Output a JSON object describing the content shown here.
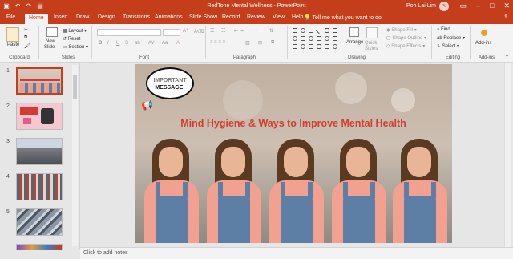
{
  "window": {
    "title": "RedTone Mental Wellness  -  PowerPoint",
    "user_name": "Poh Lai Lim",
    "user_initials": "PL"
  },
  "tabs": [
    "File",
    "Home",
    "Insert",
    "Draw",
    "Design",
    "Transitions",
    "Animations",
    "Slide Show",
    "Record",
    "Review",
    "View",
    "Help"
  ],
  "tell_me": "Tell me what you want to do",
  "ribbon": {
    "clipboard": {
      "paste": "Paste",
      "label": "Clipboard"
    },
    "slides": {
      "new_slide": "New",
      "new_slide2": "Slide",
      "layout": "Layout",
      "reset": "Reset",
      "section": "Section",
      "label": "Slides"
    },
    "font": {
      "label": "Font",
      "bold": "B",
      "italic": "I",
      "underline": "U",
      "strike": "S"
    },
    "paragraph": {
      "label": "Paragraph"
    },
    "drawing": {
      "arrange": "Arrange",
      "quick_styles": "Quick Styles",
      "shape_fill": "Shape Fill",
      "shape_outline": "Shape Outline",
      "shape_effects": "Shape Effects",
      "label": "Drawing"
    },
    "editing": {
      "find": "Find",
      "replace": "Replace",
      "select": "Select",
      "label": "Editing"
    },
    "addins": {
      "addins": "Add-ins",
      "label": "Add-ins"
    }
  },
  "slides_panel": {
    "thumbnails": [
      {
        "number": "1",
        "selected": true
      },
      {
        "number": "2",
        "selected": false
      },
      {
        "number": "3",
        "selected": false
      },
      {
        "number": "4",
        "selected": false
      },
      {
        "number": "5",
        "selected": false
      }
    ]
  },
  "slide": {
    "bubble_line1": "IMPORTANT",
    "bubble_line2": "MESSAGE!",
    "headline": "Mind Hygiene & Ways to Improve Mental Health"
  },
  "notes_placeholder": "Click to add notes",
  "colors": {
    "accent": "#c43e1c",
    "headline": "#d23c32"
  },
  "icons": [
    "save-icon",
    "undo-icon",
    "redo-icon",
    "present-icon",
    "megaphone-icon",
    "lightbulb-icon"
  ]
}
